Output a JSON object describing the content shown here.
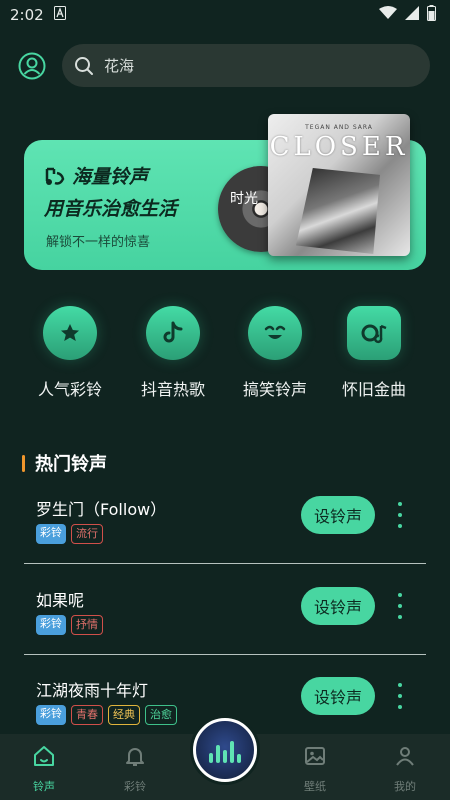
{
  "status_bar": {
    "time": "2:02",
    "icons": [
      "notification-a-icon",
      "wifi-icon",
      "signal-icon",
      "battery-icon"
    ]
  },
  "search": {
    "query": "花海"
  },
  "banner": {
    "line1": "海量铃声",
    "line2": "用音乐治愈生活",
    "line3": "解锁不一样的惊喜",
    "disc_title": "时光",
    "cover_subtitle": "TEGAN AND SARA",
    "cover_title": "CLOSER"
  },
  "categories": [
    {
      "label": "人气彩铃",
      "icon": "medal-star-icon"
    },
    {
      "label": "抖音热歌",
      "icon": "tiktok-icon"
    },
    {
      "label": "搞笑铃声",
      "icon": "funny-face-icon"
    },
    {
      "label": "怀旧金曲",
      "icon": "radio-note-icon"
    }
  ],
  "section": {
    "title": "热门铃声"
  },
  "songs": [
    {
      "name": "罗生门（Follow）",
      "tags": [
        "彩铃",
        "流行"
      ],
      "button": "设铃声"
    },
    {
      "name": "如果呢",
      "tags": [
        "彩铃",
        "抒情"
      ],
      "button": "设铃声"
    },
    {
      "name": "江湖夜雨十年灯",
      "tags": [
        "彩铃",
        "青春",
        "经典",
        "治愈"
      ],
      "button": "设铃声"
    }
  ],
  "tabs": [
    {
      "label": "铃声",
      "icon": "home-icon",
      "active": true
    },
    {
      "label": "彩铃",
      "icon": "bell-icon",
      "active": false
    },
    {
      "label": "壁纸",
      "icon": "image-icon",
      "active": false
    },
    {
      "label": "我的",
      "icon": "user-icon",
      "active": false
    }
  ],
  "colors": {
    "accent": "#48d6a1",
    "background": "#102420",
    "section_bar": "#f0962c"
  }
}
